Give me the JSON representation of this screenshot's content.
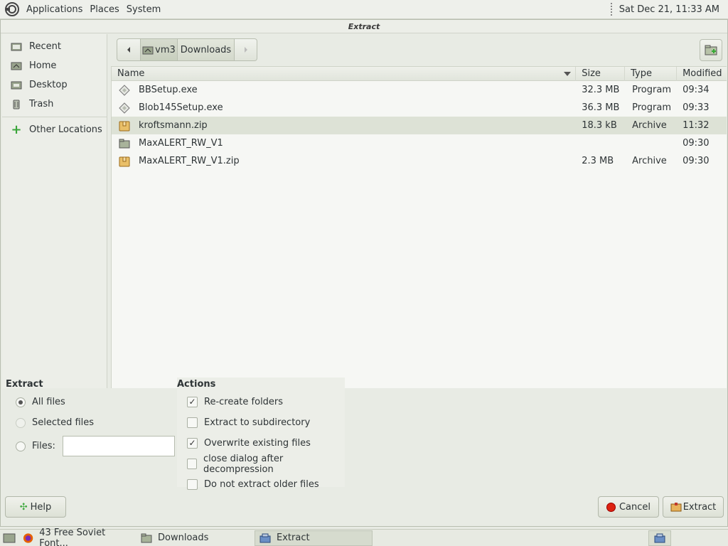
{
  "top_panel": {
    "menus": [
      "Applications",
      "Places",
      "System"
    ],
    "clock": "Sat Dec 21, 11:33 AM"
  },
  "dialog": {
    "title": "Extract",
    "sidebar": {
      "items": [
        {
          "label": "Recent",
          "icon": "recent-icon"
        },
        {
          "label": "Home",
          "icon": "home-icon"
        },
        {
          "label": "Desktop",
          "icon": "desktop-icon"
        },
        {
          "label": "Trash",
          "icon": "trash-icon"
        }
      ],
      "other": {
        "label": "Other Locations",
        "icon": "plus-icon"
      }
    },
    "pathbar": {
      "segments": [
        "vm3",
        "Downloads"
      ]
    },
    "columns": {
      "name": "Name",
      "size": "Size",
      "type": "Type",
      "modified": "Modified"
    },
    "files": [
      {
        "name": "BBSetup.exe",
        "size": "32.3 MB",
        "type": "Program",
        "modified": "09:34",
        "icon": "executable-icon"
      },
      {
        "name": "Blob145Setup.exe",
        "size": "36.3 MB",
        "type": "Program",
        "modified": "09:33",
        "icon": "executable-icon"
      },
      {
        "name": "kroftsmann.zip",
        "size": "18.3 kB",
        "type": "Archive",
        "modified": "11:32",
        "icon": "archive-icon",
        "selected": true
      },
      {
        "name": "MaxALERT_RW_V1",
        "size": "",
        "type": "",
        "modified": "09:30",
        "icon": "folder-icon"
      },
      {
        "name": "MaxALERT_RW_V1.zip",
        "size": "2.3 MB",
        "type": "Archive",
        "modified": "09:30",
        "icon": "archive-icon"
      }
    ],
    "extract_group": {
      "title": "Extract",
      "all_files": "All files",
      "selected_files": "Selected files",
      "files_label": "Files:",
      "files_value": ""
    },
    "actions_group": {
      "title": "Actions",
      "recreate_folders": "Re-create folders",
      "extract_to_subdirectory": "Extract to subdirectory",
      "overwrite_existing": "Overwrite existing files",
      "close_after": "close dialog after decompression",
      "do_not_extract_older": "Do not extract older files"
    },
    "buttons": {
      "help": "Help",
      "cancel": "Cancel",
      "extract": "Extract"
    }
  },
  "taskbar": {
    "items": [
      {
        "label": "43 Free Soviet Font...",
        "icon": "firefox-icon"
      },
      {
        "label": "Downloads",
        "icon": "folder-icon"
      },
      {
        "label": "Extract",
        "icon": "archive-manager-icon"
      }
    ]
  }
}
